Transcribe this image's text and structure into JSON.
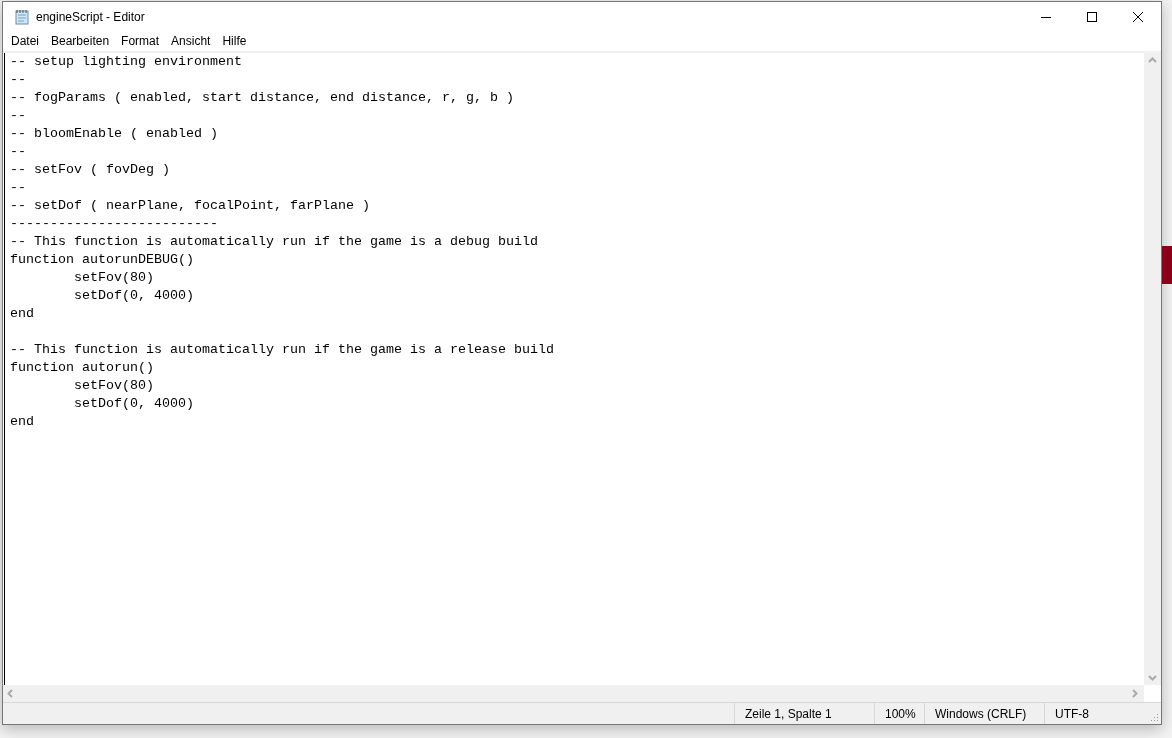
{
  "window": {
    "title": "engineScript - Editor"
  },
  "menu": [
    {
      "label": "Datei"
    },
    {
      "label": "Bearbeiten"
    },
    {
      "label": "Format"
    },
    {
      "label": "Ansicht"
    },
    {
      "label": "Hilfe"
    }
  ],
  "editor": {
    "content": "-- setup lighting environment\n--\n-- fogParams ( enabled, start distance, end distance, r, g, b )\n--\n-- bloomEnable ( enabled )\n--\n-- setFov ( fovDeg )\n--\n-- setDof ( nearPlane, focalPoint, farPlane )\n--------------------------\n-- This function is automatically run if the game is a debug build\nfunction autorunDEBUG()\n\tsetFov(80)\n\tsetDof(0, 4000)\nend\n\n-- This function is automatically run if the game is a release build\nfunction autorun()\n\tsetFov(80)\n\tsetDof(0, 4000)\nend"
  },
  "status_bar": [
    {
      "text": "Zeile 1, Spalte 1"
    },
    {
      "text": "100%"
    },
    {
      "text": "Windows (CRLF)"
    },
    {
      "text": "UTF-8"
    }
  ]
}
